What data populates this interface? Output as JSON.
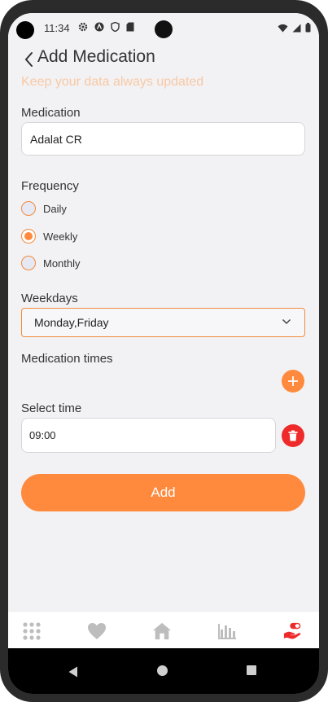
{
  "status_bar": {
    "time": "11:34",
    "left_icons": [
      "gear-icon",
      "a-logo-icon",
      "shield-icon",
      "sd-card-icon"
    ],
    "right_icons": [
      "wifi-icon",
      "signal-icon",
      "battery-icon"
    ]
  },
  "header": {
    "title": "Add Medication",
    "subtitle": "Keep your data always updated"
  },
  "medication": {
    "label": "Medication",
    "value": "Adalat CR"
  },
  "frequency": {
    "label": "Frequency",
    "options": [
      {
        "label": "Daily",
        "selected": false
      },
      {
        "label": "Weekly",
        "selected": true
      },
      {
        "label": "Monthly",
        "selected": false
      }
    ]
  },
  "weekdays": {
    "label": "Weekdays",
    "value": "Monday,Friday"
  },
  "medication_times": {
    "label": "Medication times"
  },
  "select_time": {
    "label": "Select time",
    "value": "09:00"
  },
  "actions": {
    "add_label": "Add"
  },
  "bottom_nav": {
    "items": [
      "grid-icon",
      "heart-icon",
      "home-icon",
      "bar-chart-icon",
      "medication-hand-icon"
    ],
    "active": "medication-hand-icon"
  },
  "colors": {
    "accent": "#ff8a3d",
    "subtitle": "#f8c8a4",
    "danger": "#ee2a2a",
    "nav_inactive": "#bdbdbd",
    "nav_active": "#ee2a2a"
  }
}
